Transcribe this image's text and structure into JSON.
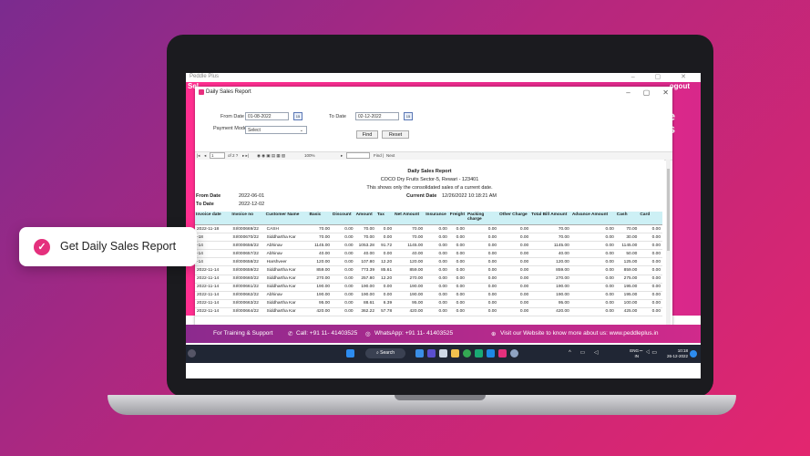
{
  "app": {
    "window_title": "Peddle Plus",
    "strip_left": "Sel",
    "strip_right": "ogout",
    "strip_side": [
      "e",
      "s"
    ]
  },
  "dialog": {
    "title": "Daily Sales Report",
    "from_date_label": "From Date",
    "from_date_value": "01-08-2022",
    "to_date_label": "To Date",
    "to_date_value": "02-12-2022",
    "payment_mode_label": "Payment Mode",
    "payment_mode_value": "Select",
    "find_button": "Find",
    "reset_button": "Reset"
  },
  "toolbar": {
    "page_value": "1",
    "page_of": "of 2 ?",
    "zoom": "100%",
    "find_label": "Find",
    "next_label": "Next"
  },
  "report": {
    "title": "Daily Sales Report",
    "company": "COCO Dry Fruits Sector-5, Rewari - 123401",
    "note": "This shows only the consolidated sales of a current date.",
    "from_date_label": "From Date",
    "from_date_value": "2022-06-01",
    "to_date_label": "To Date",
    "to_date_value": "2022-12-02",
    "current_date_label": "Current Date",
    "current_date_value": "12/26/2022 10:18:21 AM",
    "columns": [
      "Invoice date",
      "Invoice no",
      "Customer Name",
      "Basic",
      "Discount",
      "Amount",
      "Tax",
      "Net Amount",
      "Insurance",
      "Freight",
      "Packing charge",
      "Other Charge",
      "Total Bill Amount",
      "Advance Amount",
      "Cash",
      "Card"
    ],
    "rows": [
      [
        "2022-11-18",
        "SI/000669/22",
        "CASH",
        "70.00",
        "0.00",
        "70.00",
        "0.00",
        "70.00",
        "0.00",
        "0.00",
        "0.00",
        "0.00",
        "70.00",
        "0.00",
        "70.00",
        "0.00"
      ],
      [
        "-18",
        "SI/000670/22",
        "Siddhartha Kar",
        "70.00",
        "0.00",
        "70.00",
        "0.00",
        "70.00",
        "0.00",
        "0.00",
        "0.00",
        "0.00",
        "70.00",
        "0.00",
        "30.00",
        "0.00"
      ],
      [
        "-14",
        "SI/000656/22",
        "Abhinav",
        "1145.00",
        "0.00",
        "1053.28",
        "91.72",
        "1145.00",
        "0.00",
        "0.00",
        "0.00",
        "0.00",
        "1145.00",
        "0.00",
        "1145.00",
        "0.00"
      ],
      [
        "-14",
        "SI/000657/22",
        "Abhinav",
        "40.00",
        "0.00",
        "40.00",
        "0.00",
        "40.00",
        "0.00",
        "0.00",
        "0.00",
        "0.00",
        "40.00",
        "0.00",
        "50.00",
        "0.00"
      ],
      [
        "-14",
        "SI/000658/22",
        "Harshveer",
        "120.00",
        "0.00",
        "107.80",
        "12.20",
        "120.00",
        "0.00",
        "0.00",
        "0.00",
        "0.00",
        "120.00",
        "0.00",
        "125.00",
        "0.00"
      ],
      [
        "2022-11-14",
        "SI/000659/22",
        "Siddhartha Kar",
        "859.00",
        "0.00",
        "773.39",
        "85.61",
        "859.00",
        "0.00",
        "0.00",
        "0.00",
        "0.00",
        "859.00",
        "0.00",
        "859.00",
        "0.00"
      ],
      [
        "2022-11-14",
        "SI/000660/22",
        "Siddhartha Kar",
        "270.00",
        "0.00",
        "257.80",
        "12.20",
        "270.00",
        "0.00",
        "0.00",
        "0.00",
        "0.00",
        "270.00",
        "0.00",
        "275.00",
        "0.00"
      ],
      [
        "2022-11-14",
        "SI/000661/22",
        "Siddhartha Kar",
        "190.00",
        "0.00",
        "190.00",
        "0.00",
        "190.00",
        "0.00",
        "0.00",
        "0.00",
        "0.00",
        "190.00",
        "0.00",
        "195.00",
        "0.00"
      ],
      [
        "2022-11-14",
        "SI/000662/22",
        "Abhinav",
        "190.00",
        "0.00",
        "190.00",
        "0.00",
        "190.00",
        "0.00",
        "0.00",
        "0.00",
        "0.00",
        "190.00",
        "0.00",
        "195.00",
        "0.00"
      ],
      [
        "2022-11-14",
        "SI/000663/22",
        "Siddhartha Kar",
        "95.00",
        "0.00",
        "88.61",
        "6.39",
        "95.00",
        "0.00",
        "0.00",
        "0.00",
        "0.00",
        "95.00",
        "0.00",
        "100.00",
        "0.00"
      ],
      [
        "2022-11-14",
        "SI/000664/22",
        "Siddhartha Kar",
        "420.00",
        "0.00",
        "362.22",
        "57.78",
        "420.00",
        "0.00",
        "0.00",
        "0.00",
        "0.00",
        "420.00",
        "0.00",
        "425.00",
        "0.00"
      ]
    ]
  },
  "footer": {
    "training": "For Training & Support",
    "call": "Call: +91 11- 41403525",
    "whatsapp": "WhatsApp: +91 11- 41403525",
    "website": "Visit our Website to know more about us: www.peddleplus.in"
  },
  "taskbar": {
    "search_label": "Search",
    "lang": "ENG",
    "region": "IN",
    "time": "10:18",
    "date": "26-12-2022"
  },
  "callout": {
    "text": "Get Daily Sales Report"
  },
  "colors": {
    "accent": "#e4307d",
    "header_row": "#cdf0f5",
    "taskbar": "#202634"
  }
}
